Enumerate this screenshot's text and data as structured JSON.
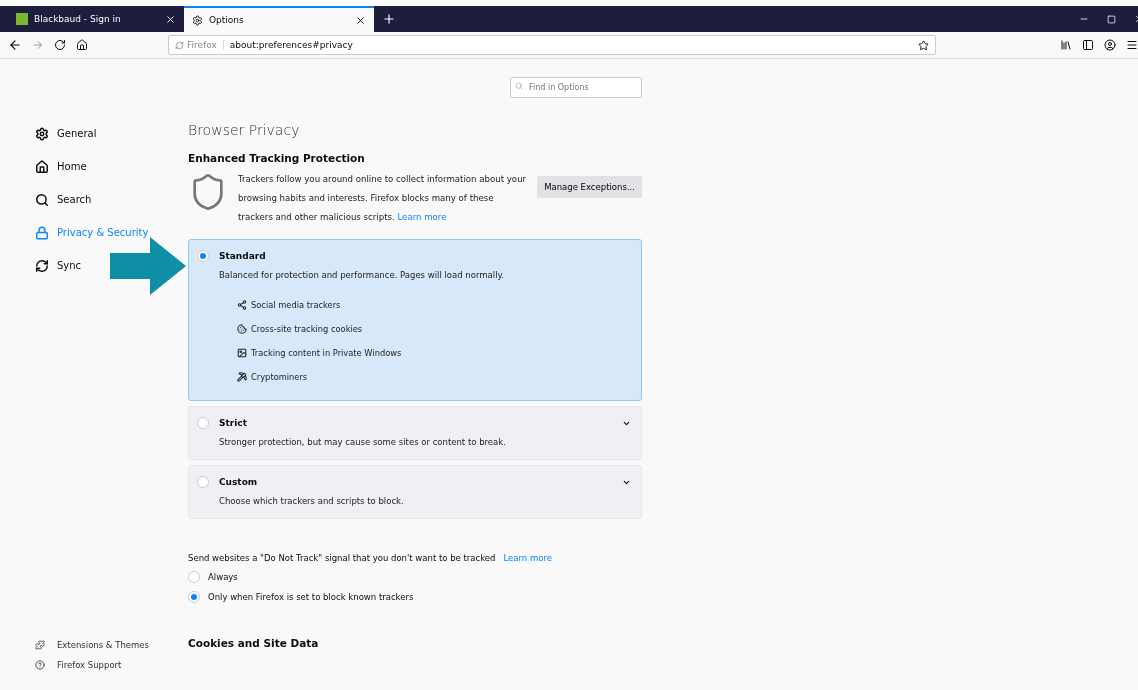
{
  "tabs": [
    {
      "title": "Blackbaud - Sign in",
      "selected": false
    },
    {
      "title": "Options",
      "selected": true
    }
  ],
  "address": {
    "identity": "Firefox",
    "url": "about:preferences#privacy"
  },
  "search": {
    "placeholder": "Find in Options"
  },
  "sidebar": {
    "items": [
      {
        "label": "General",
        "selected": false
      },
      {
        "label": "Home",
        "selected": false
      },
      {
        "label": "Search",
        "selected": false
      },
      {
        "label": "Privacy & Security",
        "selected": true
      },
      {
        "label": "Sync",
        "selected": false
      }
    ],
    "footer": [
      "Extensions & Themes",
      "Firefox Support"
    ]
  },
  "page_title": "Browser Privacy",
  "etp": {
    "heading": "Enhanced Tracking Protection",
    "description": "Trackers follow you around online to collect information about your browsing habits and interests. Firefox blocks many of these trackers and other malicious scripts.",
    "learn_more": "Learn more",
    "button": "Manage Exceptions..."
  },
  "protection_levels": [
    {
      "name": "Standard",
      "description": "Balanced for protection and performance. Pages will load normally.",
      "selected": true,
      "expanded": true,
      "items": [
        "Social media trackers",
        "Cross-site tracking cookies",
        "Tracking content in Private Windows",
        "Cryptominers"
      ]
    },
    {
      "name": "Strict",
      "description": "Stronger protection, but may cause some sites or content to break.",
      "selected": false,
      "expanded": false
    },
    {
      "name": "Custom",
      "description": "Choose which trackers and scripts to block.",
      "selected": false,
      "expanded": false
    }
  ],
  "do_not_track": {
    "label": "Send websites a \"Do Not Track\" signal that you don't want to be tracked",
    "learn_more": "Learn more",
    "options": [
      {
        "label": "Always",
        "selected": false
      },
      {
        "label": "Only when Firefox is set to block known trackers",
        "selected": true
      }
    ]
  },
  "next_section": "Cookies and Site Data"
}
